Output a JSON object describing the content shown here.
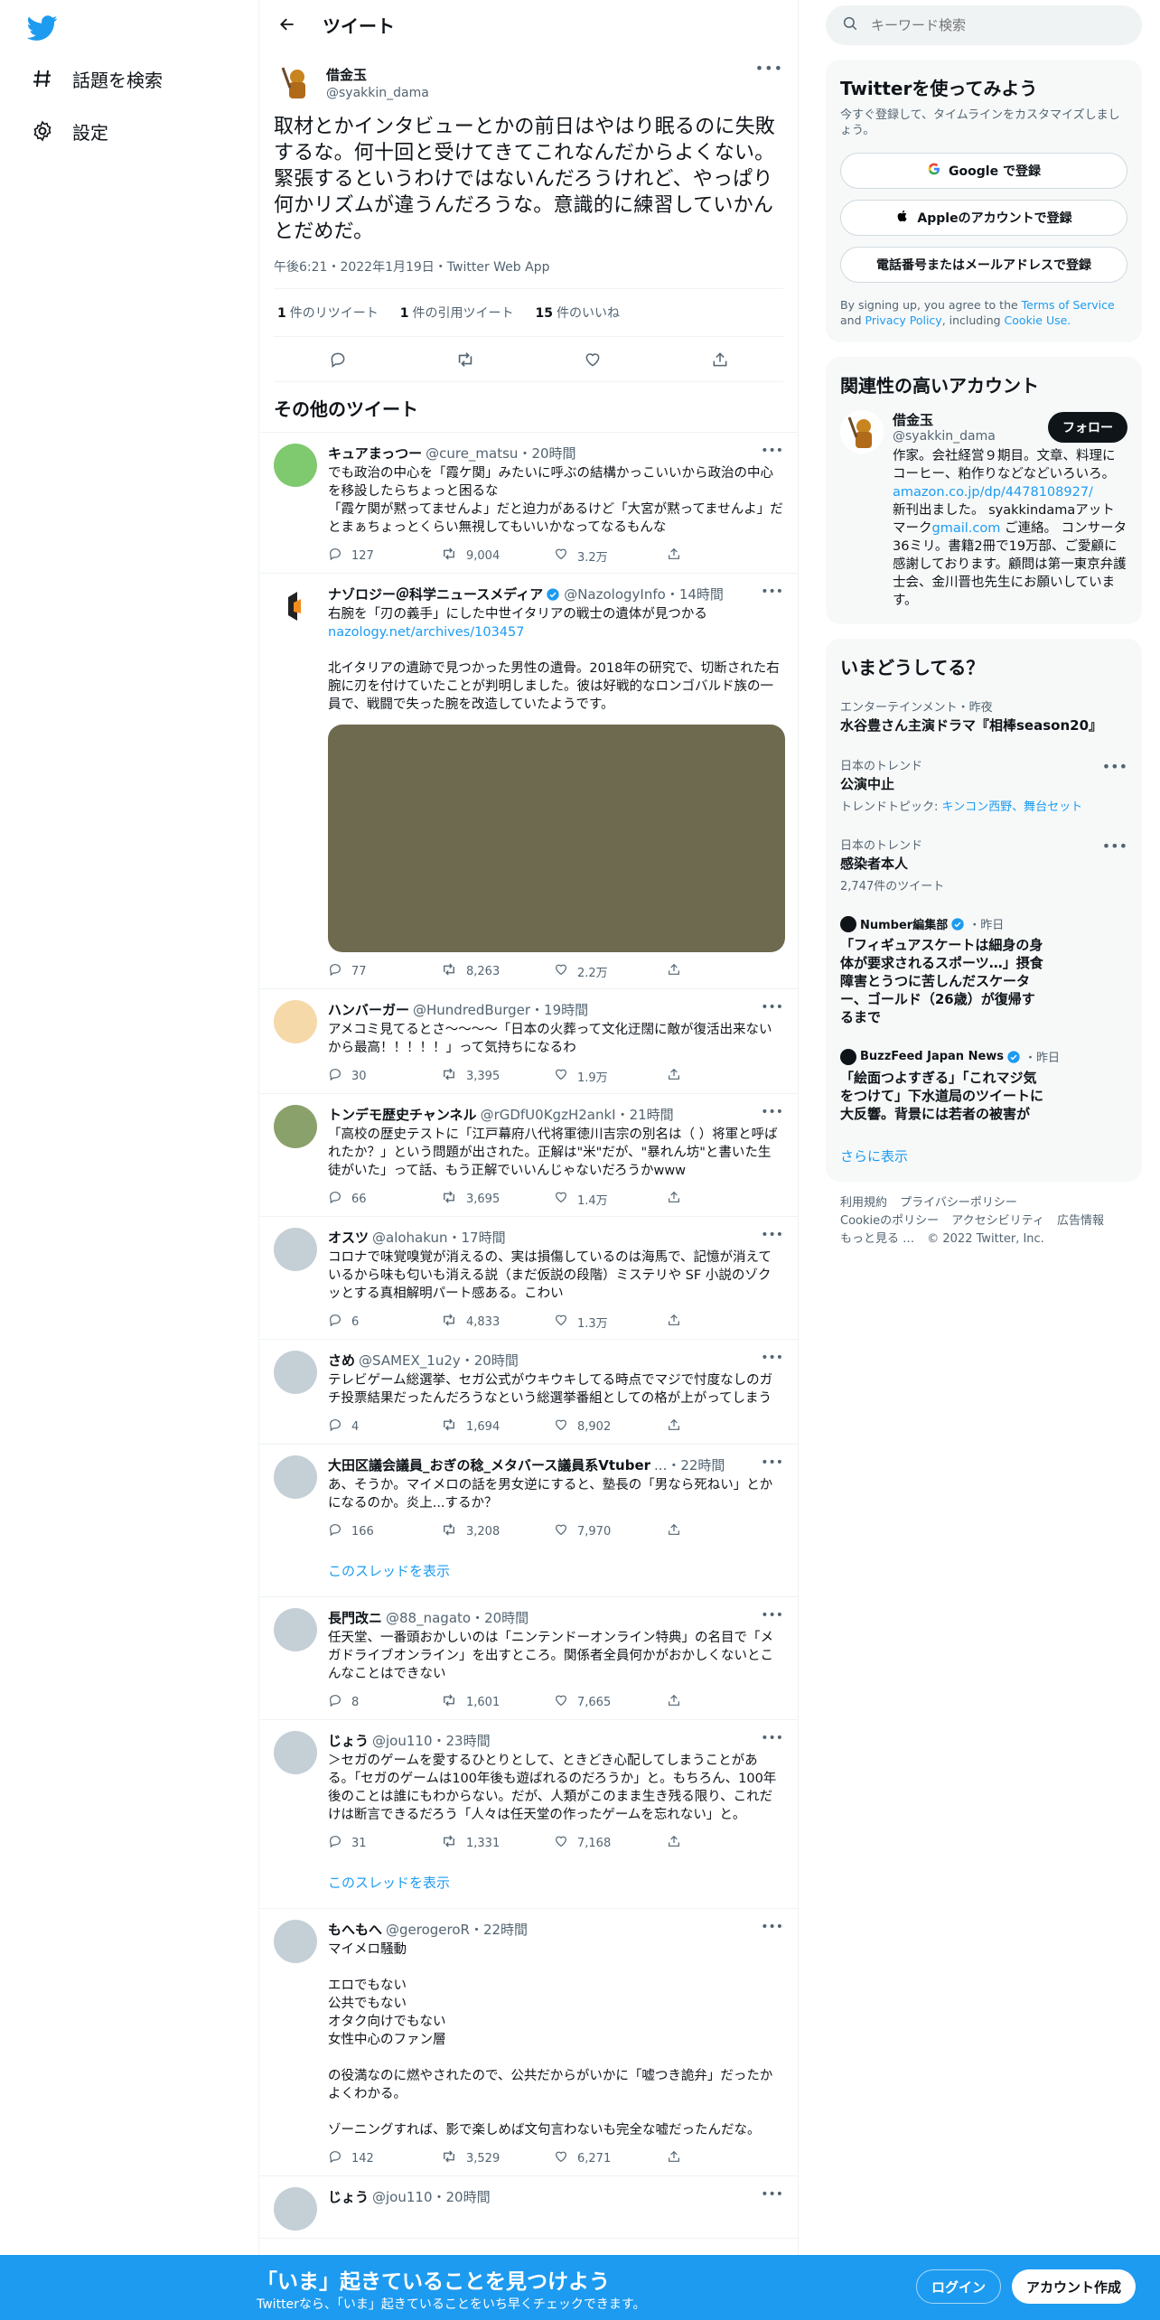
{
  "nav": {
    "items": [
      {
        "label": "話題を検索",
        "icon": "hashtag-icon"
      },
      {
        "label": "設定",
        "icon": "gear-icon"
      }
    ]
  },
  "header": {
    "title": "ツイート"
  },
  "main_tweet": {
    "display_name": "借金玉",
    "handle": "@syakkin_dama",
    "text": "取材とかインタビューとかの前日はやはり眠るのに失敗するな。何十回と受けてきてこれなんだからよくない。緊張するというわけではないんだろうけれど、やっぱり何かリズムが違うんだろうな。意識的に練習していかんとだめだ。",
    "meta": "午後6:21・2022年1月19日・Twitter Web App",
    "stats": [
      {
        "count": "1",
        "label": "件のリツイート"
      },
      {
        "count": "1",
        "label": "件の引用ツイート"
      },
      {
        "count": "15",
        "label": "件のいいね"
      }
    ]
  },
  "more_tweets_header": "その他のツイート",
  "tweets": [
    {
      "name": "キュアまっつー",
      "handle": "@cure_matsu",
      "time": "・20時間",
      "text": "でも政治の中心を「霞ケ関」みたいに呼ぶの結構かっこいいから政治の中心を移設したらちょっと困るな\n「霞ケ関が黙ってませんよ」だと迫力があるけど「大宮が黙ってませんよ」だとまぁちょっとくらい無視してもいいかなってなるもんな",
      "reply": "127",
      "rt": "9,004",
      "like": "3.2万"
    },
    {
      "name": "ナゾロジー＠科学ニュースメディア",
      "handle": "@NazologyInfo",
      "time": "・14時間",
      "link": "nazology.net/archives/103457",
      "text_before": "右腕を「刃の義手」にした中世イタリアの戦士の遺体が見つかる",
      "text": "北イタリアの遺跡で見つかった男性の遺骨。2018年の研究で、切断された右腕に刃を付けていたことが判明しました。彼は好戦的なロンゴバルド族の一員で、戦闘で失った腕を改造していたようです。",
      "reply": "77",
      "rt": "8,263",
      "like": "2.2万"
    },
    {
      "name": "ハンバーガー",
      "handle": "@HundredBurger",
      "time": "・19時間",
      "text": "アメコミ見てるとさ〜〜〜〜「日本の火葬って文化迂闊に敵が復活出来ないから最高！！！！！」って気持ちになるわ",
      "reply": "30",
      "rt": "3,395",
      "like": "1.9万"
    },
    {
      "name": "トンデモ歴史チャンネル",
      "handle": "@rGDfU0KgzH2ankI",
      "time": "・21時間",
      "text": "「高校の歴史テストに「江戸幕府八代将軍徳川吉宗の別名は（ ）将軍と呼ばれたか？」という問題が出された。正解は\"米\"だが、\"暴れん坊\"と書いた生徒がいた」って話、もう正解でいいんじゃないだろうかwww",
      "reply": "66",
      "rt": "3,695",
      "like": "1.4万"
    },
    {
      "name": "オスツ",
      "handle": "@alohakun",
      "time": "・17時間",
      "text": "コロナで味覚嗅覚が消えるの、実は損傷しているのは海馬で、記憶が消えているから味も匂いも消える説（まだ仮説の段階）ミステリや SF 小説のゾクッとする真相解明パート感ある。こわい",
      "reply": "6",
      "rt": "4,833",
      "like": "1.3万"
    },
    {
      "name": "さめ",
      "handle": "@SAMEX_1u2y",
      "time": "・20時間",
      "text": "テレビゲーム総選挙、セガ公式がウキウキしてる時点でマジで忖度なしのガチ投票結果だったんだろうなという総選挙番組としての格が上がってしまう",
      "reply": "4",
      "rt": "1,694",
      "like": "8,902"
    },
    {
      "name": "大田区議会議員_おぎの稔_メタバース議員系Vtuber",
      "handle": "...",
      "time": "・22時間",
      "text": "あ、そうか。マイメロの話を男女逆にすると、塾長の「男なら死ねい」とかになるのか。炎上...するか？",
      "reply": "166",
      "rt": "3,208",
      "like": "7,970",
      "thread": "このスレッドを表示"
    },
    {
      "name": "長門改ニ",
      "handle": "@88_nagato",
      "time": "・20時間",
      "text": "任天堂、一番頭おかしいのは「ニンテンドーオンライン特典」の名目で「メガドライブオンライン」を出すところ。関係者全員何かがおかしくないとこんなことはできない",
      "reply": "8",
      "rt": "1,601",
      "like": "7,665"
    },
    {
      "name": "じょう",
      "handle": "@jou110",
      "time": "・23時間",
      "text": "＞セガのゲームを愛するひとりとして、ときどき心配してしまうことがある。「セガのゲームは100年後も遊ばれるのだろうか」と。もちろん、100年後のことは誰にもわからない。だが、人類がこのまま生き残る限り、これだけは断言できるだろう「人々は任天堂の作ったゲームを忘れない」と。",
      "reply": "31",
      "rt": "1,331",
      "like": "7,168",
      "thread": "このスレッドを表示"
    },
    {
      "name": "もへもへ",
      "handle": "@gerogeroR",
      "time": "・22時間",
      "text": "マイメロ騒動\n\nエロでもない\n公共でもない\nオタク向けでもない\n女性中心のファン層\n\nの役満なのに燃やされたので、公共だからがいかに「嘘つき詭弁」だったかよくわかる。\n\nゾーニングすれば、影で楽しめば文句言わないも完全な嘘だったんだな。",
      "reply": "142",
      "rt": "3,529",
      "like": "6,271"
    },
    {
      "name": "じょう",
      "handle": "@jou110",
      "time": "・20時間",
      "text": "",
      "reply": "",
      "rt": "",
      "like": ""
    }
  ],
  "right": {
    "search_placeholder": "キーワード検索",
    "signup": {
      "title": "Twitterを使ってみよう",
      "subtitle": "今すぐ登録して、タイムラインをカスタマイズしましょう。",
      "google": "Google で登録",
      "apple": "Appleのアカウントで登録",
      "phone": "電話番号またはメールアドレスで登録",
      "terms_prefix": "By signing up, you agree to the ",
      "terms": "Terms of Service",
      "and": " and ",
      "privacy": "Privacy Policy",
      "including": ", including ",
      "cookie": "Cookie Use."
    },
    "relevant": {
      "title": "関連性の高いアカウント",
      "name": "借金玉",
      "handle": "@syakkin_dama",
      "follow": "フォロー",
      "bio_1": "作家。会社経営９期目。文章、料理にコーヒー、粕作りなどなどいろいろ。",
      "bio_link1": "amazon.co.jp/dp/4478108927/",
      "bio_2": "新刊出ました。 syakkindamaアットマーク",
      "bio_link2": "gmail.com",
      "bio_3": " ご連絡。 コンサータ36ミリ。書籍2冊で19万部、ご愛顧に感謝しております。顧問は第一東京弁護士会、金川晋也先生にお願いしています。"
    },
    "trends": {
      "title": "いまどうしてる？",
      "items": [
        {
          "ctx": "エンターテインメント・昨夜",
          "title": "水谷豊さん主演ドラマ『相棒season20』"
        },
        {
          "ctx": "日本のトレンド",
          "title": "公演中止",
          "sub_prefix": "トレンドトピック: ",
          "sub_links": "キンコン西野、舞台セット"
        },
        {
          "ctx": "日本のトレンド",
          "title": "感染者本人",
          "sub": "2,747件のツイート"
        }
      ],
      "news": [
        {
          "src": "Number編集部",
          "time": "・昨日",
          "title": "「フィギュアスケートは細身の身体が要求されるスポーツ…」摂食障害とうつに苦しんだスケーター、ゴールド（26歳）が復帰するまで"
        },
        {
          "src": "BuzzFeed Japan News",
          "time": "・昨日",
          "title": "「絵面つよすぎる」「これマジ気をつけて」下水道局のツイートに大反響。背景には若者の被害が"
        }
      ],
      "show_more": "さらに表示"
    },
    "footer": [
      "利用規約",
      "プライバシーポリシー",
      "Cookieのポリシー",
      "アクセシビリティ",
      "広告情報",
      "もっと見る …",
      "© 2022 Twitter, Inc."
    ]
  },
  "bottom": {
    "title": "「いま」起きていることを見つけよう",
    "subtitle": "Twitterなら、「いま」起きていることをいち早くチェックできます。",
    "login": "ログイン",
    "signup": "アカウント作成"
  },
  "colors": {
    "accent": "#1d9bf0",
    "text": "#0f1419",
    "muted": "#536471"
  }
}
